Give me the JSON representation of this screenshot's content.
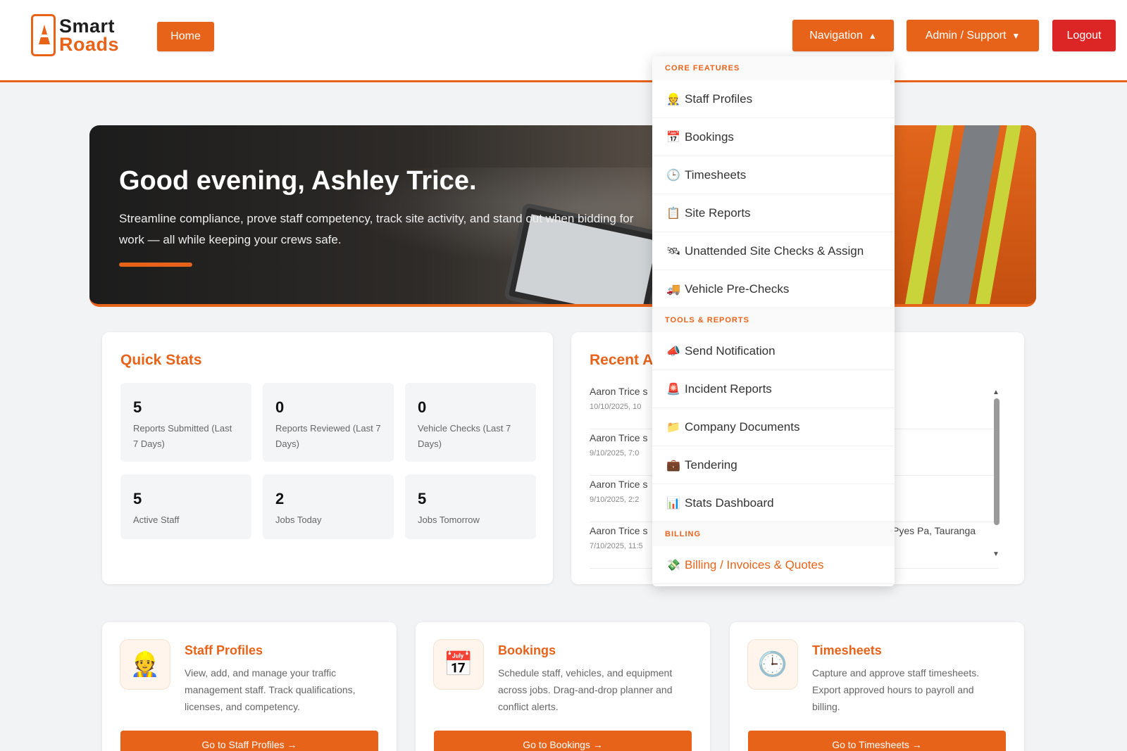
{
  "brand": {
    "line1": "Smart",
    "line2": "Roads"
  },
  "header": {
    "home_label": "Home",
    "nav_label": "Navigation",
    "nav_caret": "▲",
    "admin_label": "Admin / Support",
    "admin_caret": "▼",
    "logout_label": "Logout"
  },
  "hero": {
    "greeting": "Good evening, Ashley Trice.",
    "subtitle": "Streamline compliance, prove staff competency, track site activity, and stand out when bidding for work — all while keeping your crews safe."
  },
  "quick_stats": {
    "title": "Quick Stats",
    "items": [
      {
        "value": "5",
        "label": "Reports Submitted (Last 7 Days)"
      },
      {
        "value": "0",
        "label": "Reports Reviewed (Last 7 Days)"
      },
      {
        "value": "0",
        "label": "Vehicle Checks (Last 7 Days)"
      },
      {
        "value": "5",
        "label": "Active Staff"
      },
      {
        "value": "2",
        "label": "Jobs Today"
      },
      {
        "value": "5",
        "label": "Jobs Tomorrow"
      }
    ]
  },
  "recent_activity": {
    "title": "Recent A",
    "rows": [
      {
        "who": "Aaron Trice s",
        "when": "10/10/2025, 10",
        "where": ""
      },
      {
        "who": "Aaron Trice s",
        "when": "9/10/2025, 7:0",
        "where": ""
      },
      {
        "who": "Aaron Trice s",
        "when": "9/10/2025, 2:2",
        "where": ""
      },
      {
        "who": "Aaron Trice s",
        "when": "7/10/2025, 11:5",
        "where": "Pyes Pa, Tauranga"
      }
    ]
  },
  "features": [
    {
      "icon": "👷",
      "title": "Staff Profiles",
      "desc": "View, add, and manage your traffic management staff. Track qualifications, licenses, and competency.",
      "button": "Go to Staff Profiles →"
    },
    {
      "icon": "📅",
      "title": "Bookings",
      "desc": "Schedule staff, vehicles, and equipment across jobs. Drag-and-drop planner and conflict alerts.",
      "button": "Go to Bookings →"
    },
    {
      "icon": "🕒",
      "title": "Timesheets",
      "desc": "Capture and approve staff timesheets. Export approved hours to payroll and billing.",
      "button": "Go to Timesheets →"
    }
  ],
  "nav_menu": {
    "sections": [
      {
        "heading": "CORE FEATURES",
        "items": [
          {
            "icon": "👷",
            "label": "Staff Profiles"
          },
          {
            "icon": "📅",
            "label": "Bookings"
          },
          {
            "icon": "🕒",
            "label": "Timesheets"
          },
          {
            "icon": "📋",
            "label": "Site Reports"
          },
          {
            "icon": "🛰",
            "label": "Unattended Site Checks & Assign"
          },
          {
            "icon": "🚚",
            "label": "Vehicle Pre-Checks"
          }
        ]
      },
      {
        "heading": "TOOLS & REPORTS",
        "items": [
          {
            "icon": "📣",
            "label": "Send Notification"
          },
          {
            "icon": "🚨",
            "label": "Incident Reports"
          },
          {
            "icon": "📁",
            "label": "Company Documents"
          },
          {
            "icon": "💼",
            "label": "Tendering"
          },
          {
            "icon": "📊",
            "label": "Stats Dashboard"
          }
        ]
      },
      {
        "heading": "BILLING",
        "items": [
          {
            "icon": "💸",
            "label": "Billing / Invoices & Quotes"
          }
        ]
      }
    ]
  },
  "colors": {
    "accent": "#e8631a",
    "danger": "#dc2626"
  }
}
